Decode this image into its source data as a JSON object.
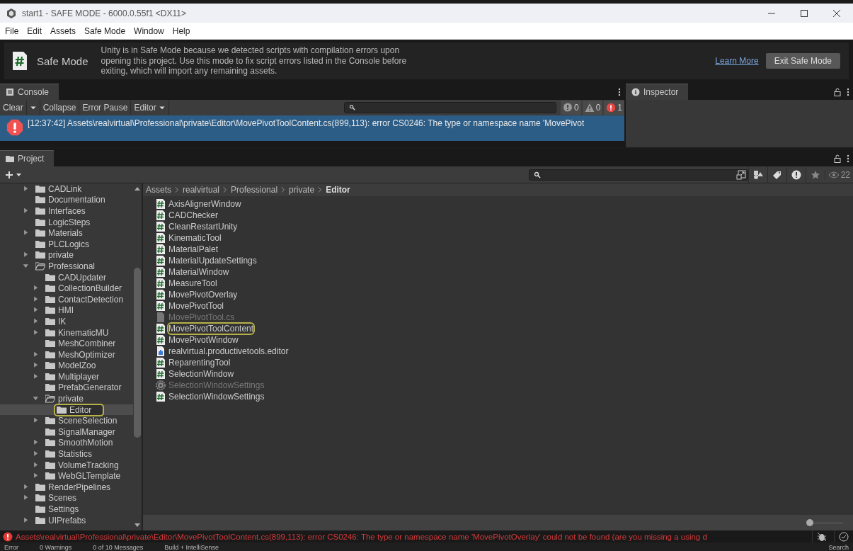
{
  "window": {
    "title": "start1 - SAFE MODE - 6000.0.55f1 <DX11>"
  },
  "menu": [
    "File",
    "Edit",
    "Assets",
    "Safe Mode",
    "Window",
    "Help"
  ],
  "safe_mode_banner": {
    "title": "Safe Mode",
    "message": "Unity is in Safe Mode because we detected scripts with compilation errors upon opening this project. Use this mode to fix script errors listed in the Console before exiting, which will import any remaining assets.",
    "link": "Learn More",
    "button": "Exit Safe Mode"
  },
  "console": {
    "tab": "Console",
    "toolbar": [
      "Clear",
      "Collapse",
      "Error Pause",
      "Editor"
    ],
    "counts": [
      {
        "kind": "info",
        "count": "0"
      },
      {
        "kind": "warning",
        "count": "0"
      },
      {
        "kind": "error",
        "count": "1"
      }
    ],
    "entries": [
      {
        "kind": "error",
        "selected": true,
        "text": "[12:37:42] Assets\\realvirtual\\Professional\\private\\Editor\\MovePivotToolContent.cs(899,113): error CS0246: The type or namespace name 'MovePivot"
      }
    ]
  },
  "inspector": {
    "tab": "Inspector"
  },
  "project": {
    "tab": "Project",
    "hidden_count": "22",
    "tree": [
      {
        "label": "CADLink",
        "expanded": false,
        "selected": false
      },
      {
        "label": "Documentation",
        "selected": false
      },
      {
        "label": "Interfaces",
        "expanded": false,
        "selected": false
      },
      {
        "label": "LogicSteps",
        "selected": false
      },
      {
        "label": "Materials",
        "expanded": false,
        "selected": false
      },
      {
        "label": "PLCLogics",
        "selected": false
      },
      {
        "label": "private",
        "expanded": false,
        "selected": false
      },
      {
        "label": "Professional",
        "expanded": true,
        "selected": false,
        "children": [
          {
            "label": "CADUpdater",
            "selected": false
          },
          {
            "label": "CollectionBuilder",
            "expanded": false,
            "selected": false
          },
          {
            "label": "ContactDetection",
            "expanded": false,
            "selected": false
          },
          {
            "label": "HMI",
            "expanded": false,
            "selected": false
          },
          {
            "label": "IK",
            "expanded": false,
            "selected": false
          },
          {
            "label": "KinematicMU",
            "expanded": false,
            "selected": false
          },
          {
            "label": "MeshCombiner",
            "selected": false
          },
          {
            "label": "MeshOptimizer",
            "expanded": false,
            "selected": false
          },
          {
            "label": "ModelZoo",
            "expanded": false,
            "selected": false
          },
          {
            "label": "Multiplayer",
            "expanded": false,
            "selected": false
          },
          {
            "label": "PrefabGenerator",
            "selected": false
          },
          {
            "label": "private",
            "expanded": true,
            "selected": false,
            "children": [
              {
                "label": "Editor",
                "selected": true
              }
            ]
          },
          {
            "label": "SceneSelection",
            "expanded": false,
            "selected": false
          },
          {
            "label": "SignalManager",
            "selected": false
          },
          {
            "label": "SmoothMotion",
            "expanded": false,
            "selected": false
          },
          {
            "label": "Statistics",
            "expanded": false,
            "selected": false
          },
          {
            "label": "VolumeTracking",
            "expanded": false,
            "selected": false
          },
          {
            "label": "WebGLTemplate",
            "expanded": false,
            "selected": false
          }
        ]
      },
      {
        "label": "RenderPipelines",
        "expanded": false,
        "selected": false
      },
      {
        "label": "Scenes",
        "expanded": false,
        "selected": false
      },
      {
        "label": "Settings",
        "selected": false
      },
      {
        "label": "UIPrefabs",
        "expanded": false,
        "selected": false
      }
    ],
    "breadcrumb": [
      "Assets",
      "realvirtual",
      "Professional",
      "private",
      "Editor"
    ],
    "files": [
      {
        "name": "AxisAlignerWindow",
        "kind": "script",
        "selected": false
      },
      {
        "name": "CADChecker",
        "kind": "script",
        "selected": false
      },
      {
        "name": "CleanRestartUnity",
        "kind": "script",
        "selected": false
      },
      {
        "name": "KinematicTool",
        "kind": "script",
        "selected": false
      },
      {
        "name": "MaterialPalet",
        "kind": "script",
        "selected": false
      },
      {
        "name": "MaterialUpdateSettings",
        "kind": "script",
        "selected": false
      },
      {
        "name": "MaterialWindow",
        "kind": "script",
        "selected": false
      },
      {
        "name": "MeasureTool",
        "kind": "script",
        "selected": false
      },
      {
        "name": "MovePivotOverlay",
        "kind": "script",
        "selected": false
      },
      {
        "name": "MovePivotTool",
        "kind": "script",
        "selected": false
      },
      {
        "name": "MovePivotTool.cs",
        "kind": "text",
        "selected": false
      },
      {
        "name": "MovePivotToolContent",
        "kind": "script",
        "selected": true
      },
      {
        "name": "MovePivotWindow",
        "kind": "script",
        "selected": false
      },
      {
        "name": "realvirtual.productivetools.editor",
        "kind": "assembly",
        "selected": false
      },
      {
        "name": "ReparentingTool",
        "kind": "script",
        "selected": false
      },
      {
        "name": "SelectionWindow",
        "kind": "script",
        "selected": false
      },
      {
        "name": "SelectionWindowSettings",
        "kind": "settings",
        "selected": false
      },
      {
        "name": "SelectionWindowSettings",
        "kind": "script",
        "selected": false
      }
    ]
  },
  "size_slider": {
    "level": 0
  },
  "status_bar": {
    "message": "Assets\\realvirtual\\Professional\\private\\Editor\\MovePivotToolContent.cs(899,113): error CS0246: The type or namespace name 'MovePivotOverlay' could not be found (are you missing a using d"
  },
  "background_window": {
    "items": [
      "Error",
      "0 Warnings",
      "0 of 10 Messages",
      "Build + IntelliSense",
      "Search"
    ]
  }
}
